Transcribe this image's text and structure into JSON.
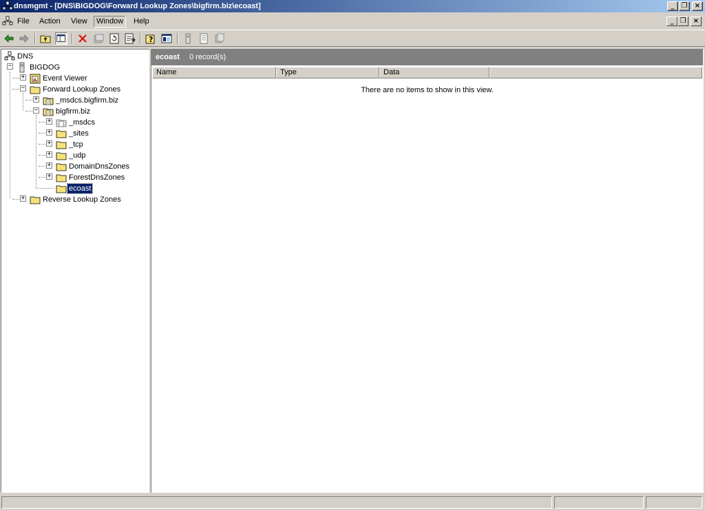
{
  "window": {
    "title": "dnsmgmt - [DNS\\BIGDOG\\Forward Lookup Zones\\bigfirm.biz\\ecoast]",
    "minimize_glyph": "_",
    "restore_glyph": "❐",
    "close_glyph": "×"
  },
  "menu": {
    "file": "File",
    "action": "Action",
    "view": "View",
    "window": "Window",
    "help": "Help"
  },
  "toolbar": {
    "icons": [
      "back-arrow-icon",
      "forward-arrow-icon",
      "up-folder-icon",
      "show-hide-tree-icon",
      "delete-icon",
      "properties-icon",
      "refresh-icon",
      "export-list-icon",
      "help-icon",
      "console-window-icon",
      "server-icon",
      "zone-icon",
      "record-icon"
    ]
  },
  "tree": {
    "root": "DNS",
    "server": "BIGDOG",
    "event_viewer": "Event Viewer",
    "forward_zones": "Forward Lookup Zones",
    "msdcs_zone": "_msdcs.bigfirm.biz",
    "bigfirm_zone": "bigfirm.biz",
    "sub_msdcs": "_msdcs",
    "sub_sites": "_sites",
    "sub_tcp": "_tcp",
    "sub_udp": "_udp",
    "sub_domaindns": "DomainDnsZones",
    "sub_forestdns": "ForestDnsZones",
    "sub_ecoast": "ecoast",
    "reverse_zones": "Reverse Lookup Zones"
  },
  "result": {
    "header_name": "ecoast",
    "header_count": "0 record(s)",
    "columns": [
      "Name",
      "Type",
      "Data"
    ],
    "empty_message": "There are no items to show in this view."
  },
  "colors": {
    "titlebar_start": "#0a246a",
    "titlebar_end": "#a6caf0",
    "selection": "#0a246a",
    "folder": "#f5e27a"
  }
}
